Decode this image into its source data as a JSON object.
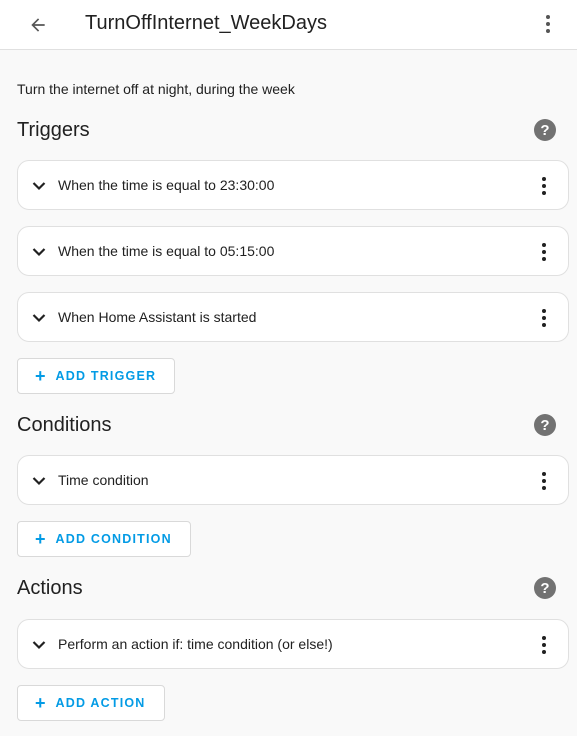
{
  "header": {
    "title": "TurnOffInternet_WeekDays",
    "back_icon": "arrow-left-icon",
    "menu_icon": "dots-vertical-icon"
  },
  "description": "Turn the internet off at night, during the week",
  "triggers": {
    "title": "Triggers",
    "help_symbol": "?",
    "items": [
      {
        "label": "When the time is equal to 23:30:00"
      },
      {
        "label": "When the time is equal to 05:15:00"
      },
      {
        "label": "When Home Assistant is started"
      }
    ],
    "add_label": "ADD TRIGGER"
  },
  "conditions": {
    "title": "Conditions",
    "help_symbol": "?",
    "items": [
      {
        "label": "Time condition"
      }
    ],
    "add_label": "ADD CONDITION"
  },
  "actions": {
    "title": "Actions",
    "help_symbol": "?",
    "items": [
      {
        "label": "Perform an action if: time condition (or else!)"
      }
    ],
    "add_label": "ADD ACTION"
  },
  "colors": {
    "accent": "#039be5",
    "help_icon": "#727272",
    "background": "#f9f9f9"
  }
}
